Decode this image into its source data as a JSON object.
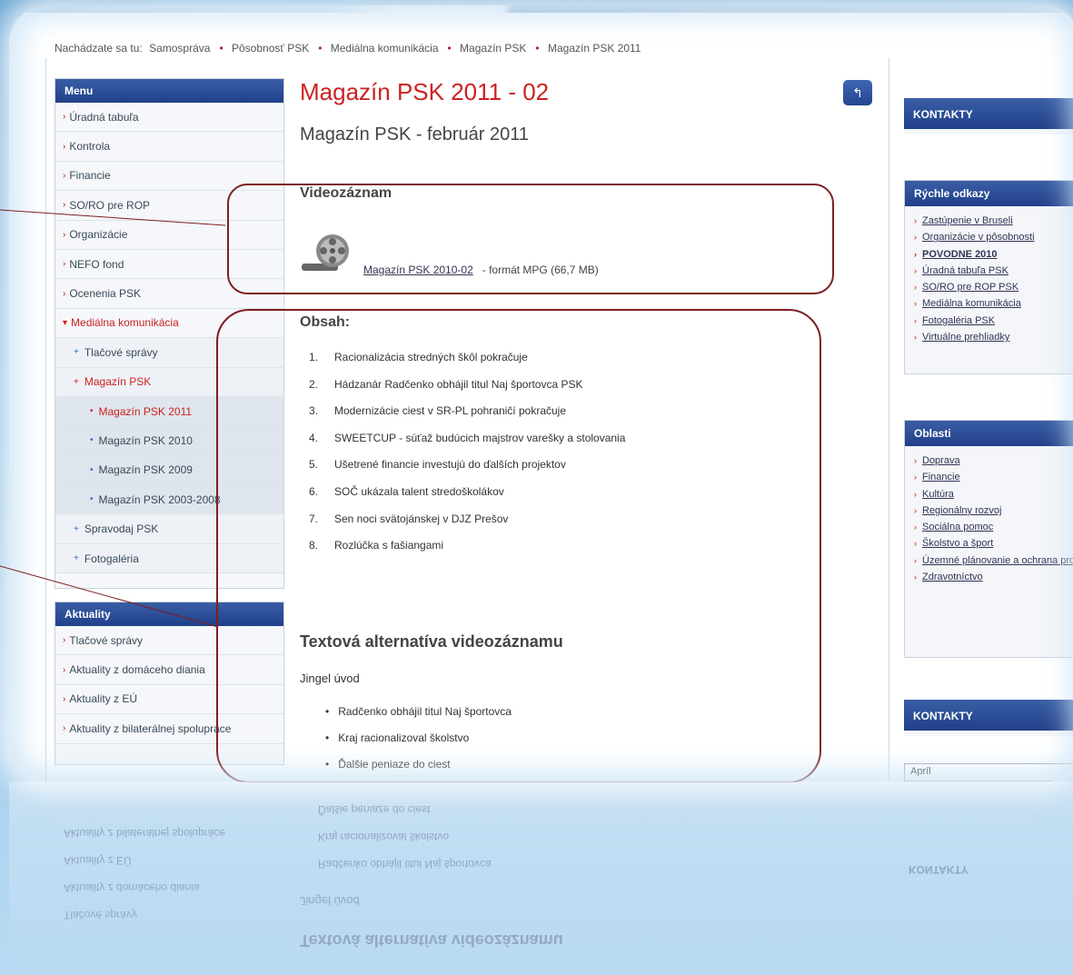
{
  "breadcrumb": {
    "prefix": "Nachádzate sa tu:",
    "items": [
      "Samospráva",
      "Pôsobnosť PSK",
      "Mediálna komunikácia",
      "Magazín PSK",
      "Magazín PSK 2011"
    ]
  },
  "menu": {
    "title": "Menu",
    "items": [
      {
        "label": "Úradná tabuľa",
        "level": 0
      },
      {
        "label": "Kontrola",
        "level": 0
      },
      {
        "label": "Financie",
        "level": 0
      },
      {
        "label": "SO/RO pre ROP",
        "level": 0
      },
      {
        "label": "Organizácie",
        "level": 0
      },
      {
        "label": "NEFO fond",
        "level": 0
      },
      {
        "label": "Ocenenia PSK",
        "level": 0
      },
      {
        "label": "Mediálna komunikácia",
        "level": 0,
        "active": true
      },
      {
        "label": "Tlačové správy",
        "level": 1
      },
      {
        "label": "Magazín PSK",
        "level": 1,
        "active": true
      },
      {
        "label": "Magazín PSK 2011",
        "level": 2,
        "active": true
      },
      {
        "label": "Magazín PSK 2010",
        "level": 2
      },
      {
        "label": "Magazín PSK 2009",
        "level": 2
      },
      {
        "label": "Magazín PSK 2003-2008",
        "level": 2
      },
      {
        "label": "Spravodaj PSK",
        "level": 1
      },
      {
        "label": "Fotogaléria",
        "level": 1
      }
    ]
  },
  "news": {
    "title": "Aktuality",
    "items": [
      "Tlačové správy",
      "Aktuality z domáceho diania",
      "Aktuality z EÚ",
      "Aktuality z bilaterálnej spolupráce"
    ]
  },
  "main": {
    "title": "Magazín PSK 2011 - 02",
    "subtitle": "Magazín PSK - február 2011",
    "video_heading": "Videozáznam",
    "video_link": "Magazín PSK 2010-02",
    "video_format": "- formát MPG (66,7 MB)",
    "contents_heading": "Obsah:",
    "contents": [
      "Racionalizácia stredných škôl pokračuje",
      "Hádzanár Radčenko obhájil titul Naj športovca PSK",
      "Modernizácie ciest v SR-PL pohraničí pokračuje",
      "SWEETCUP - súťaž budúcich majstrov varešky a stolovania",
      "Ušetrené financie investujú do ďalších projektov",
      "SOČ ukázala talent stredoškolákov",
      "Sen noci svätojánskej v DJZ Prešov",
      "Rozlúčka s fašiangami"
    ],
    "alt_heading": "Textová alternatíva videozáznamu",
    "jingle": "Jingel úvod",
    "bullets": [
      "Radčenko obhájil titul Naj športovca",
      "Kraj racionalizoval školstvo",
      "Ďalšie peniaze do ciest"
    ]
  },
  "back_icon": "back-arrow-icon",
  "right": {
    "contacts_title": "KONTAKTY",
    "quick_title": "Rýchle odkazy",
    "quick_links": [
      "Zastúpenie v Bruseli",
      "Organizácie v pôsobnosti",
      "POVODNE 2010",
      "Úradná tabuľa PSK",
      "SO/RO pre ROP PSK",
      "Mediálna komunikácia",
      "Fotogaléria PSK",
      "Virtuálne prehliadky"
    ],
    "areas_title": "Oblasti",
    "areas": [
      "Doprava",
      "Financie",
      "Kultúra",
      "Regionálny rozvoj",
      "Sociálna pomoc",
      "Školstvo a šport",
      "Územné plánovanie a ochrana prostredia",
      "Zdravotníctvo"
    ],
    "contacts2_title": "KONTAKTY",
    "month_select": "Apríl"
  },
  "colors": {
    "accent": "#c22222",
    "nav": "#20408a",
    "annotation": "#7d1f20"
  }
}
